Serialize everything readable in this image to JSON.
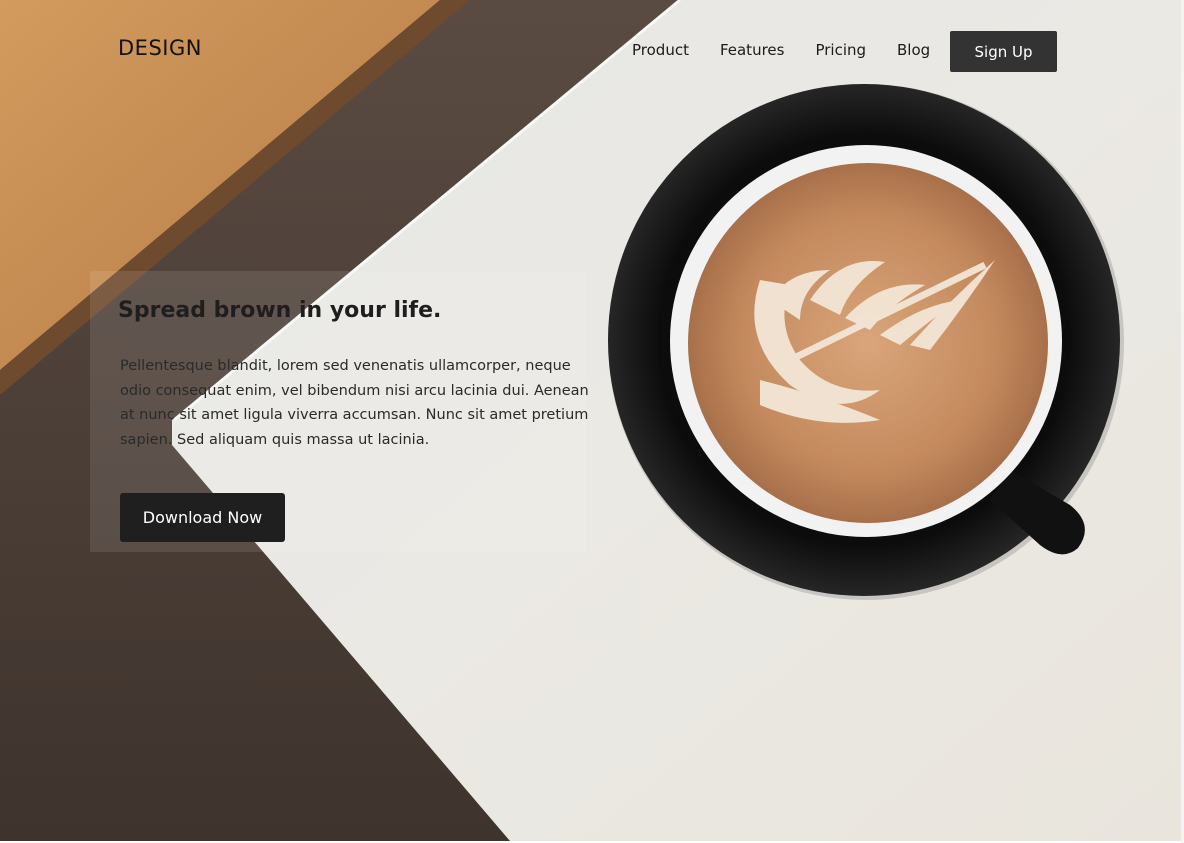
{
  "header": {
    "logo": "DESIGN",
    "nav": [
      "Product",
      "Features",
      "Pricing",
      "Blog"
    ],
    "signup_label": "Sign Up"
  },
  "hero": {
    "title": "Spread brown in your life.",
    "body": "Pellentesque blandit, lorem sed venenatis ullamcorper, neque odio consequat enim, vel bibendum nisi arcu lacinia dui. Aenean at nunc sit amet ligula viverra accumsan. Nunc sit amet pretium sapien. Sed aliquam quis massa ut lacinia.",
    "cta_label": "Download Now"
  },
  "colors": {
    "button_dark": "#333333",
    "cta_dark": "#1f1f1f",
    "table_white": "#ebe9e4",
    "coffee": "#c48a5e",
    "wood": "#c79052"
  }
}
